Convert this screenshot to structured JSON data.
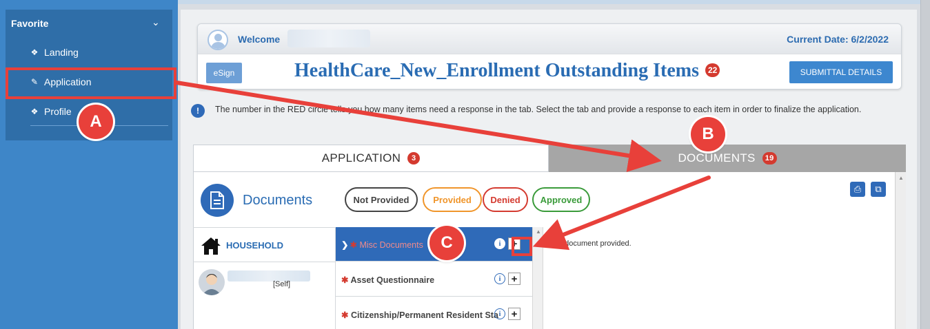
{
  "sidebar": {
    "header": "Favorite",
    "items": [
      {
        "label": "Landing"
      },
      {
        "label": "Application"
      },
      {
        "label": "Profile"
      }
    ]
  },
  "header": {
    "welcome_label": "Welcome",
    "current_date": "Current Date: 6/2/2022",
    "esign_label": "eSign",
    "title": "HealthCare_New_Enrollment Outstanding Items",
    "outstanding_count": "22",
    "submittal_label": "SUBMITTAL DETAILS"
  },
  "info": {
    "icon_glyph": "!",
    "text": "The number in the RED circle tells you how many items need a response in the tab. Select the tab and provide a response to each item in order to finalize the application."
  },
  "tabs": [
    {
      "label": "APPLICATION",
      "count": "3"
    },
    {
      "label": "DOCUMENTS",
      "count": "19"
    }
  ],
  "documents": {
    "title": "Documents",
    "legend": [
      {
        "label": "Not Provided",
        "color": "#444444"
      },
      {
        "label": "Provided",
        "color": "#f0952a"
      },
      {
        "label": "Denied",
        "color": "#d43a2f"
      },
      {
        "label": "Approved",
        "color": "#3a9b3a"
      }
    ],
    "household_label": "HOUSEHOLD",
    "member_relation": "[Self]",
    "items": [
      {
        "label": "Misc Documents",
        "active": true
      },
      {
        "label": "Asset Questionnaire",
        "active": false
      },
      {
        "label": "Citizenship/Permanent Resident Status",
        "active": false
      }
    ],
    "empty_message": "No document provided."
  },
  "annotations": {
    "A": "A",
    "B": "B",
    "C": "C",
    "color": "#e8403a"
  }
}
